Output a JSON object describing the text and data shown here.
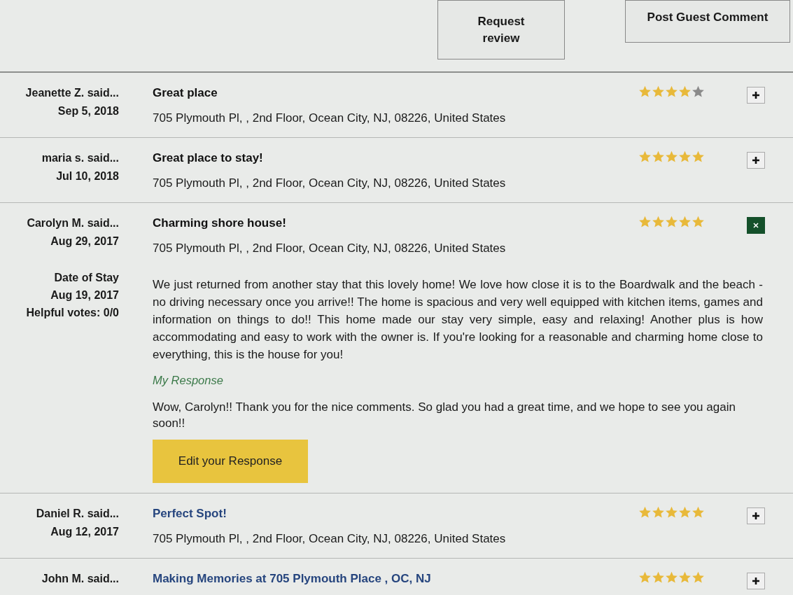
{
  "top_buttons": [
    "Request review",
    "Post Guest Comment"
  ],
  "reviews": [
    {
      "author": "Jeanette Z. said...",
      "date": "Sep 5, 2018",
      "title": "Great place",
      "visited": true,
      "address": "705 Plymouth Pl, , 2nd Floor, Ocean City, NJ, 08226, United States",
      "stars": 4,
      "expanded": false
    },
    {
      "author": "maria s. said...",
      "date": "Jul 10, 2018",
      "title": "Great place to stay!",
      "visited": true,
      "address": "705 Plymouth Pl, , 2nd Floor, Ocean City, NJ, 08226, United States",
      "stars": 5,
      "expanded": false
    },
    {
      "author": "Carolyn M. said...",
      "date": "Aug 29, 2017",
      "title": "Charming shore house!",
      "visited": true,
      "address": "705 Plymouth Pl, , 2nd Floor, Ocean City, NJ, 08226, United States",
      "stars": 5,
      "expanded": true,
      "details": {
        "stay_label": "Date of Stay",
        "stay_date": "Aug 19, 2017",
        "helpful": "Helpful votes: 0/0",
        "body": "We just returned from another stay that this lovely home! We love how close it is to the Boardwalk and the beach - no driving necessary once you arrive!! The home is spacious and very well equipped with kitchen items, games and information on things to do!! This home made our stay very simple, easy and relaxing! Another plus is how accommodating and easy to work with the owner is. If you're looking for a reasonable and charming home close to everything, this is the house for you!",
        "response_label": "My Response",
        "response": "Wow, Carolyn!! Thank you for the nice comments. So glad you had a great time, and we hope to see you again soon!!",
        "edit_button": "Edit your Response"
      }
    },
    {
      "author": "Daniel R. said...",
      "date": "Aug 12, 2017",
      "title": "Perfect Spot!",
      "visited": false,
      "address": "705 Plymouth Pl, , 2nd Floor, Ocean City, NJ, 08226, United States",
      "stars": 5,
      "expanded": false
    },
    {
      "author": "John M. said...",
      "title": "Making Memories at 705 Plymouth Place , OC, NJ",
      "visited": false,
      "stars": 5,
      "expanded": false
    }
  ]
}
